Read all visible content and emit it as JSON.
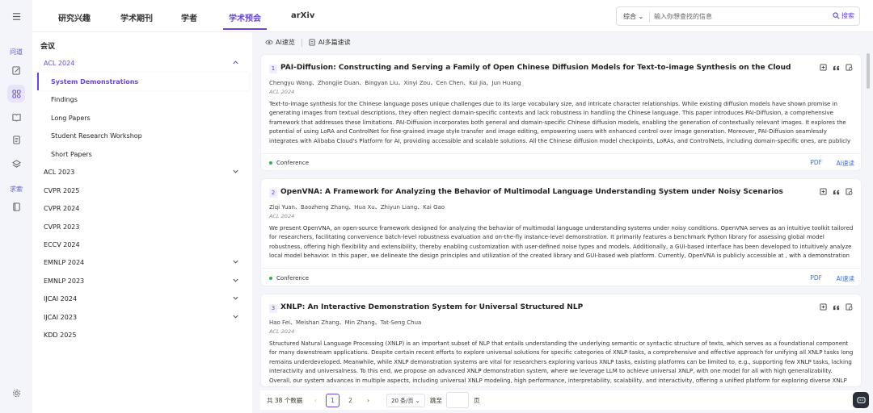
{
  "rail": {
    "items": [
      {
        "icon": "menu-icon"
      },
      {
        "label": "问道"
      },
      {
        "icon": "edit-note-icon"
      },
      {
        "icon": "discover-icon"
      },
      {
        "icon": "book-icon"
      },
      {
        "icon": "document-icon"
      },
      {
        "icon": "layers-icon"
      },
      {
        "label": "求索"
      },
      {
        "icon": "library-icon"
      },
      {
        "icon": "settings-icon"
      }
    ],
    "wen_dao": "问道",
    "qiu_suo": "求索"
  },
  "nav": {
    "tabs": [
      "研究兴趣",
      "学术期刊",
      "学者",
      "学术预会",
      "arXiv"
    ],
    "active_tab": "学术预会"
  },
  "search": {
    "scope": "综合",
    "placeholder": "输入你想查找的信息",
    "button": "搜索"
  },
  "sidebar": {
    "header": "会议",
    "items": [
      {
        "label": "ACL 2024",
        "expanded": true,
        "chevron": "up"
      },
      {
        "label": "System Demonstrations",
        "selected": true
      },
      {
        "label": "Findings"
      },
      {
        "label": "Long Papers"
      },
      {
        "label": "Student Research Workshop"
      },
      {
        "label": "Short Papers"
      },
      {
        "label": "ACL 2023",
        "chevron": "down"
      },
      {
        "label": "CVPR 2025"
      },
      {
        "label": "CVPR 2024"
      },
      {
        "label": "CVPR 2023"
      },
      {
        "label": "ECCV 2024"
      },
      {
        "label": "EMNLP 2024",
        "chevron": "down"
      },
      {
        "label": "EMNLP 2023",
        "chevron": "down"
      },
      {
        "label": "IJCAI 2024",
        "chevron": "down"
      },
      {
        "label": "IJCAI 2023",
        "chevron": "down"
      },
      {
        "label": "KDD 2025"
      }
    ]
  },
  "toolbar": {
    "ai_skim": "AI速览",
    "ai_multi": "AI多篇速读"
  },
  "papers": [
    {
      "num": "1",
      "title": "PAI-Diffusion: Constructing and Serving a Family of Open Chinese Diffusion Models for Text-to-image Synthesis on the Cloud",
      "authors": "Chengyu Wang、Zhongjie Duan、Bingyan Liu、Xinyi Zou、Cen Chen、Kui Jia、Jun Huang",
      "venue": "ACL  2024",
      "abstract": "Text-to-image synthesis for the Chinese language poses unique challenges due to its large vocabulary size, and intricate character relationships. While existing diffusion models have shown promise in generating images from textual descriptions, they often neglect domain-specific contexts and lack robustness in handling the Chinese language. This paper introduces PAI-Diffusion, a comprehensive framework that addresses these limitations. PAI-Diffusion incorporates both general and domain-specific Chinese diffusion models, enabling the generation of contextually relevant images. It explores the potential of using LoRA and ControlNet for fine-grained image style transfer and image editing, empowering users with enhanced control over image generation. Moreover, PAI-Diffusion seamlessly integrates with Alibaba Cloud's Platform for AI, providing accessible and scalable solutions. All the Chinese diffusion model checkpoints, LoRAs, and ControlNets, including domain-specific ones, are publicly available. A user-friendly Chinese WebUI and the diffusers-api elastic...",
      "category": "Conference",
      "pdf": "PDF",
      "ai": "AI速读"
    },
    {
      "num": "2",
      "title": "OpenVNA: A Framework for Analyzing the Behavior of Multimodal Language Understanding System under Noisy Scenarios",
      "authors": "Ziqi Yuan、Baozheng Zhang、Hua Xu、Zhiyun Liang、Kai Gao",
      "venue": "ACL  2024",
      "abstract": "We present OpenVNA, an open-source framework designed for analyzing the behavior of multimodal language understanding systems under noisy conditions. OpenVNA serves as an intuitive toolkit tailored for researchers, facilitating convenience batch-level robustness evaluation and on-the-fly instance-level demonstration. It primarily features a benchmark Python library for assessing global model robustness, offering high flexibility and extensibility, thereby enabling customization with user-defined noise types and models. Additionally, a GUI-based interface has been developed to intuitively analyze local model behavior. In this paper, we delineate the design principles and utilization of the created library and GUI-based web platform. Currently, OpenVNA is publicly accessible at , with a demonstration video available at .",
      "category": "Conference",
      "pdf": "PDF",
      "ai": "AI速读"
    },
    {
      "num": "3",
      "title": "XNLP: An Interactive Demonstration System for Universal Structured NLP",
      "authors": "Hao Fei、Meishan Zhang、Min Zhang、Tat-Seng Chua",
      "venue": "ACL  2024",
      "abstract": "Structured Natural Language Processing (XNLP) is an important subset of NLP that entails understanding the underlying semantic or syntactic structure of texts, which serves as a foundational component for many downstream applications. Despite certain recent efforts to explore universal solutions for specific categories of XNLP tasks, a comprehensive and effective approach for unifying all XNLP tasks long remains underdeveloped. Meanwhile, while XNLP demonstration systems are vital for researchers exploring various XNLP tasks, existing platforms can be limited to, e.g., supporting few XNLP tasks, lacking interactivity and universalness. To this end, we propose an advanced XNLP demonstration system, where we leverage LLM to achieve universal XNLP, with one model for all with high generalizability. Overall, our system advances in multiple aspects, including universal XNLP modeling, high performance, interpretability, scalability, and interactivity, offering a unified platform for exploring diverse XNLP tasks in the community."
    }
  ],
  "pagination": {
    "total": "共 38 个数据",
    "pages": [
      "1",
      "2"
    ],
    "current": "1",
    "page_size": "20 条/页",
    "goto": "跳至",
    "page_suffix": "页"
  },
  "colors": {
    "accent": "#6a45d8",
    "link": "#3b6fd8",
    "conference_dot": "#35b04a"
  }
}
